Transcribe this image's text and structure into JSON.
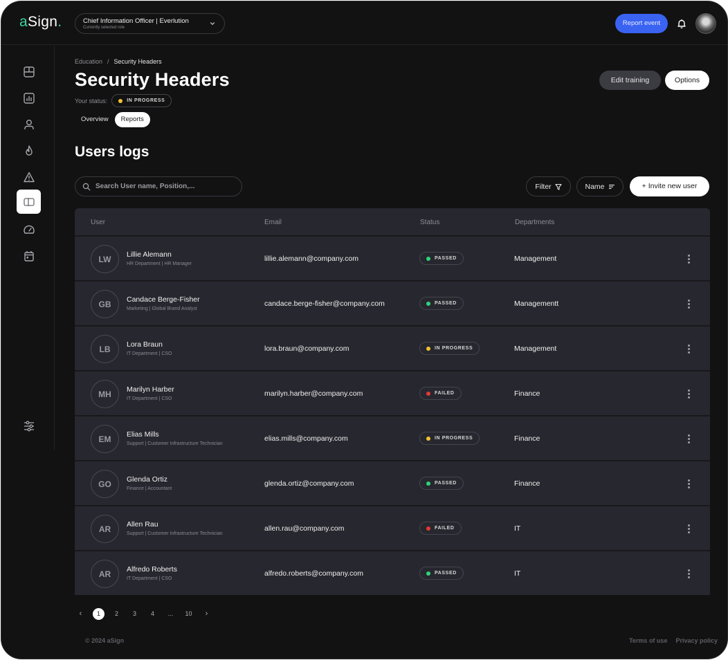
{
  "app": {
    "logo_a": "a",
    "logo_rest": "Sign",
    "logo_dot": ".",
    "role": {
      "title": "Chief Information Officer | Everlution",
      "subtitle": "Currently selected role"
    },
    "report_event_label": "Report event",
    "icons": {
      "bell": "bell-icon",
      "avatar": "user-avatar"
    }
  },
  "sidebar": {
    "items": [
      {
        "name": "dashboard",
        "icon": "layout-icon",
        "active": false
      },
      {
        "name": "analytics",
        "icon": "bar-chart-icon",
        "active": false
      },
      {
        "name": "users",
        "icon": "user-icon",
        "active": false
      },
      {
        "name": "threats",
        "icon": "flame-icon",
        "active": false
      },
      {
        "name": "alerts",
        "icon": "warning-icon",
        "active": false
      },
      {
        "name": "education",
        "icon": "book-icon",
        "active": true
      },
      {
        "name": "performance",
        "icon": "gauge-icon",
        "active": false
      },
      {
        "name": "calendar",
        "icon": "calendar-icon",
        "active": false
      }
    ],
    "settings_icon": "sliders-icon"
  },
  "page": {
    "breadcrumb": [
      "Education",
      "Security Headers"
    ],
    "breadcrumb_sep": "/",
    "title": "Security Headers",
    "status_label": "Your status:",
    "status_value": "IN PROGRESS",
    "status_color": "#f2c230",
    "tabs": [
      {
        "label": "Overview",
        "active": false
      },
      {
        "label": "Reports",
        "active": true
      }
    ],
    "edit_training_label": "Edit training",
    "options_label": "Options"
  },
  "users_logs": {
    "title": "Users logs",
    "search_placeholder": "Search User name, Position,...",
    "filter_label": "Filter",
    "sort_label": "Name",
    "invite_label": "+ Invite new user",
    "columns": [
      "User",
      "Email",
      "Status",
      "Departments"
    ],
    "status_colors": {
      "PASSED": "#2ed47a",
      "IN PROGRESS": "#f2c230",
      "FAILED": "#e53935"
    },
    "rows": [
      {
        "initials": "LW",
        "name": "Lillie Alemann",
        "role": "HR Department | HR Manager",
        "email": "lillie.alemann@company.com",
        "status": "PASSED",
        "department": "Management"
      },
      {
        "initials": "GB",
        "name": "Candace Berge-Fisher",
        "role": "Marketing | Global Brand Analyst",
        "email": "candace.berge-fisher@company.com",
        "status": "PASSED",
        "department": "Managementt"
      },
      {
        "initials": "LB",
        "name": "Lora Braun",
        "role": "IT Department | CSO",
        "email": "lora.braun@company.com",
        "status": "IN PROGRESS",
        "department": "Management"
      },
      {
        "initials": "MH",
        "name": "Marilyn Harber",
        "role": "IT Department | CSO",
        "email": "marilyn.harber@company.com",
        "status": "FAILED",
        "department": "Finance"
      },
      {
        "initials": "EM",
        "name": "Elias Mills",
        "role": "Support | Customer Infrastructure Technician",
        "email": "elias.mills@company.com",
        "status": "IN PROGRESS",
        "department": "Finance"
      },
      {
        "initials": "GO",
        "name": "Glenda Ortiz",
        "role": "Finance | Accountant",
        "email": "glenda.ortiz@company.com",
        "status": "PASSED",
        "department": "Finance"
      },
      {
        "initials": "AR",
        "name": "Allen Rau",
        "role": "Support | Customer Infrastructure Technician",
        "email": "allen.rau@company.com",
        "status": "FAILED",
        "department": "IT"
      },
      {
        "initials": "AR",
        "name": "Alfredo Roberts",
        "role": "IT Department | CSO",
        "email": "alfredo.roberts@company.com",
        "status": "PASSED",
        "department": "IT"
      }
    ]
  },
  "pagination": {
    "prev": "‹",
    "pages": [
      "1",
      "2",
      "3",
      "4",
      "...",
      "10"
    ],
    "current": "1",
    "next": "›"
  },
  "footer": {
    "copyright": "© 2024 aSign",
    "links": [
      "Terms of use",
      "Privacy policy"
    ]
  }
}
